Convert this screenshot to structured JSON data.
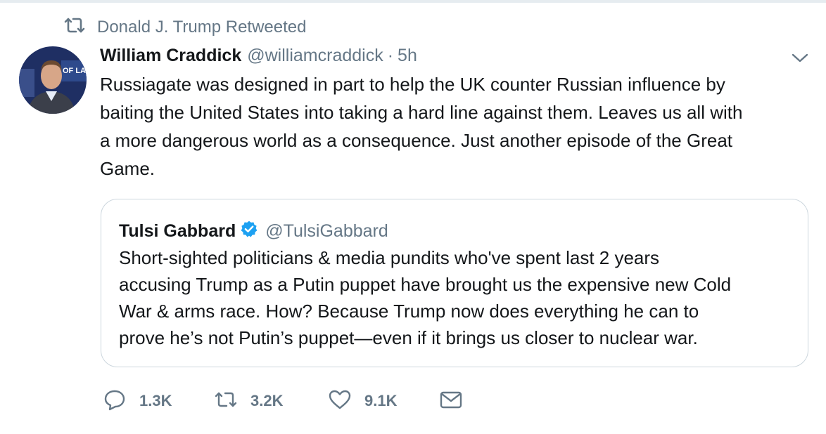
{
  "colors": {
    "text": "#14171a",
    "secondary": "#657786",
    "border": "#ccd6dd",
    "verified": "#1da1f2"
  },
  "retweet_context": {
    "icon": "retweet-icon",
    "text": "Donald J. Trump Retweeted"
  },
  "tweet": {
    "author_name": "William Craddick",
    "author_handle": "@williamcraddick",
    "separator": "·",
    "timestamp": "5h",
    "text_lines": [
      "Russiagate was designed in part to help the UK counter Russian influence by",
      "baiting the United States into taking a hard line against them. Leaves us all with",
      "a more dangerous world as a consequence. Just another episode of the Great",
      "Game."
    ]
  },
  "quoted_tweet": {
    "author_name": "Tulsi Gabbard",
    "verified": true,
    "author_handle": "@TulsiGabbard",
    "text_lines": [
      "Short-sighted politicians & media pundits who've spent last 2 years",
      "accusing Trump as a Putin puppet have brought us the expensive new Cold",
      "War & arms race. How? Because Trump now does everything he can to",
      "prove he’s not Putin’s puppet—even if it brings us closer to nuclear war."
    ]
  },
  "actions": {
    "replies": "1.3K",
    "retweets": "3.2K",
    "likes": "9.1K",
    "message_icon": "envelope-icon"
  }
}
